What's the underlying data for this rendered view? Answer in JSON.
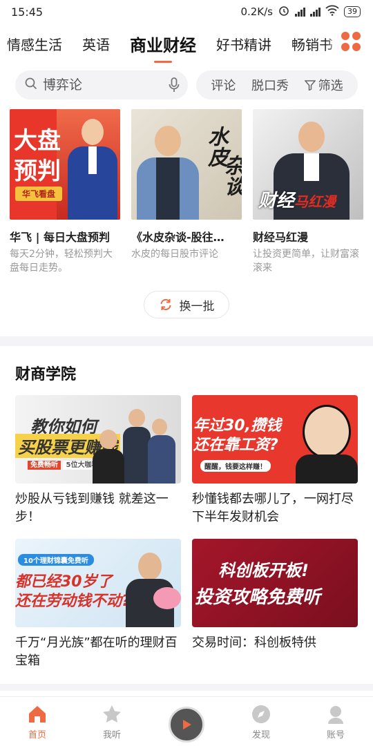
{
  "status": {
    "time": "15:45",
    "speed": "0.2K/s",
    "battery": "39"
  },
  "tabs": [
    "情感生活",
    "英语",
    "商业财经",
    "好书精讲",
    "畅销书"
  ],
  "active_tab_index": 2,
  "search": {
    "placeholder": "博弈论"
  },
  "chips": [
    "评论",
    "脱口秀",
    "筛选"
  ],
  "top_cards": [
    {
      "title": "华飞 | 每日大盘预判",
      "subtitle": "每天2分钟，轻松预判大盘每日走势。",
      "thumb_text": [
        "大盘",
        "预判"
      ],
      "thumb_tag": "华飞看盘"
    },
    {
      "title": "《水皮杂谈-股往…",
      "subtitle": "水皮的每日股市评论",
      "thumb_text": [
        "水皮",
        "杂谈"
      ]
    },
    {
      "title": "财经马红漫",
      "subtitle": "让投资更简单，让财富滚滚来",
      "thumb_text": [
        "财经",
        "马红漫"
      ]
    }
  ],
  "refresh_label": "换一批",
  "section": {
    "title": "财商学院",
    "cards": [
      {
        "title": "炒股从亏钱到赚钱 就差这一步！",
        "thumb_lines": [
          "教你如何",
          "买股票更赚钱"
        ],
        "thumb_tag": "免费畅听",
        "thumb_tag2": "5位大咖私房课"
      },
      {
        "title": "秒懂钱都去哪儿了，一网打尽下半年发财机会",
        "thumb_lines": [
          "年过30,攒钱",
          "还在靠工资?"
        ],
        "thumb_tag": "醒醒，钱要这样赚！"
      },
      {
        "title": "千万“月光族”都在听的理财百宝箱",
        "thumb_lines": [
          "都已经30岁了",
          "还在劳动钱不动?"
        ],
        "thumb_tag": "10个理财锦囊免费听"
      },
      {
        "title": "交易时间：科创板特供",
        "thumb_lines": [
          "科创板开板!",
          "投资攻略免费听"
        ]
      }
    ]
  },
  "bottom_nav": [
    "首页",
    "我听",
    "发现",
    "账号"
  ],
  "colors": {
    "accent": "#ee6a42"
  }
}
